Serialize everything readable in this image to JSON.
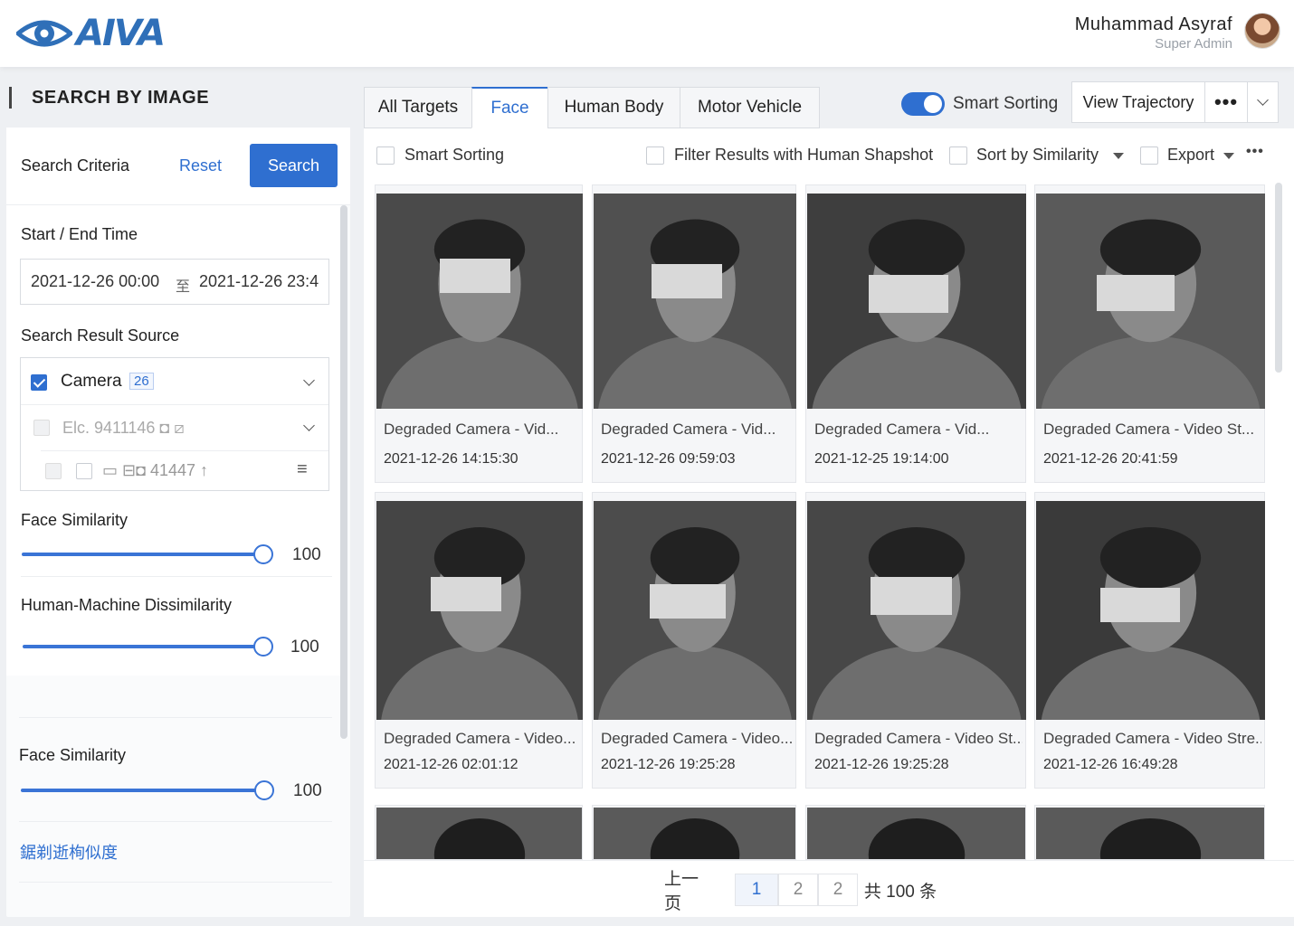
{
  "header": {
    "logo_text": "AIVA",
    "user_name": "Muhammad Asyraf",
    "user_role": "Super Admin"
  },
  "left": {
    "section_title": "SEARCH BY IMAGE",
    "criteria_label": "Search Criteria",
    "reset_label": "Reset",
    "search_label": "Search",
    "time_label": "Start / End Time",
    "time_start": "2021-12-26 00:00",
    "time_sep": "至",
    "time_end": "2021-12-26 23:4",
    "source_label": "Search Result Source",
    "source_rows": [
      {
        "label": "Camera",
        "count": "26",
        "checked": true
      },
      {
        "label": "Elc. 9411146 ◘ ⧄",
        "checked": false
      },
      {
        "label": "▭ ⊟◘ 41447 ↑",
        "checked": false
      }
    ],
    "face_similarity_label": "Face Similarity",
    "face_similarity_value": "100",
    "hm_label": "Human-Machine Dissimilarity",
    "hm_value": "100",
    "face_similarity2_label": "Face Similarity",
    "face_similarity2_value": "100",
    "garbled_link": "鋸剃逝栒似度"
  },
  "tabs": [
    "All Targets",
    "Face",
    "Human Body",
    "Motor Vehicle"
  ],
  "active_tab": "Face",
  "toolbar": {
    "smart_sorting": "Smart Sorting",
    "view_trajectory": "View Trajectory",
    "more": "•••"
  },
  "filters": {
    "smart_sorting": "Smart Sorting",
    "filter_human": "Filter Results with Human Shapshot",
    "sort_similarity": "Sort by Similarity",
    "export": "Export",
    "more": "•••"
  },
  "results": [
    {
      "caption": "Degraded Camera - Vid...",
      "time": "2021-12-26 14:15:30"
    },
    {
      "caption": "Degraded Camera - Vid...",
      "time": "2021-12-26 09:59:03"
    },
    {
      "caption": "Degraded Camera - Vid...",
      "time": "2021-12-25 19:14:00"
    },
    {
      "caption": "Degraded Camera - Video St...",
      "time": "2021-12-26 20:41:59"
    },
    {
      "caption": "Degraded Camera - Video...",
      "time": "2021-12-26 02:01:12"
    },
    {
      "caption": "Degraded Camera - Video...",
      "time": "2021-12-26 19:25:28"
    },
    {
      "caption": "Degraded Camera - Video St...",
      "time": "2021-12-26 19:25:28"
    },
    {
      "caption": "Degraded Camera - Video Stre...",
      "time": "2021-12-26 16:49:28"
    }
  ],
  "pager": {
    "prev": "上一页",
    "pages": [
      "1",
      "2",
      "2"
    ],
    "total": "共 100 条"
  },
  "colors": {
    "accent": "#2f6fd0",
    "logo": "#2f6fb8"
  }
}
